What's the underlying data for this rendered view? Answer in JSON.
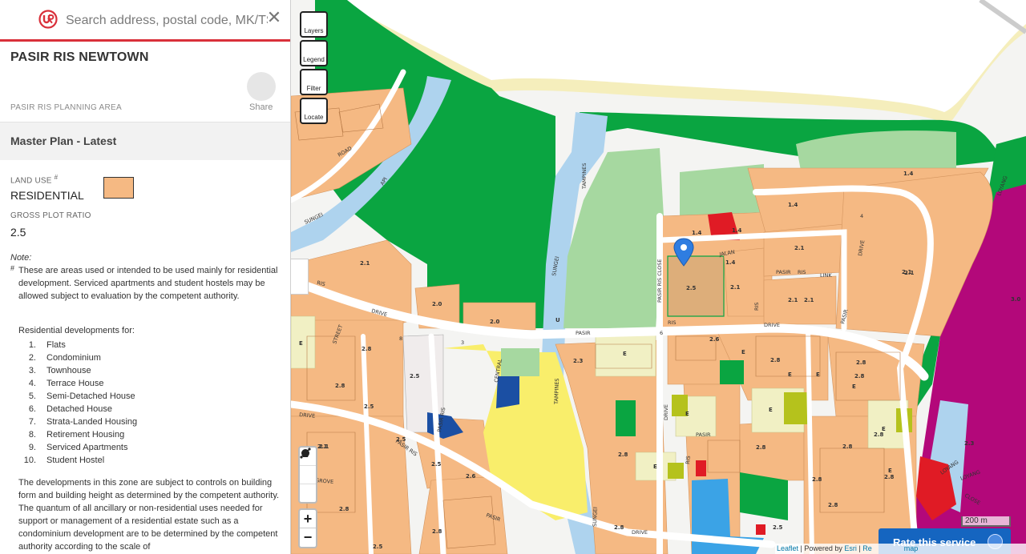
{
  "search": {
    "placeholder": "Search address, postal code, MK/TS Lot",
    "clear_label": "✕"
  },
  "place": {
    "title": "PASIR RIS NEWTOWN",
    "planning_area": "PASIR RIS PLANNING AREA",
    "share_label": "Share"
  },
  "plan": {
    "header": "Master Plan - Latest",
    "land_use_label": "LAND USE",
    "land_use_mark": "#",
    "land_use_value": "RESIDENTIAL",
    "land_use_color": "#f5b983",
    "gpr_label": "GROSS PLOT RATIO",
    "gpr_value": "2.5"
  },
  "note": {
    "label": "Note:",
    "mark": "#",
    "text": "These are areas used or intended to be used mainly for residential development. Serviced apartments and student hostels may be allowed subject to evaluation by the competent authority.",
    "list_intro": "Residential developments for:",
    "types": [
      "Flats",
      "Condominium",
      "Townhouse",
      "Terrace House",
      "Semi-Detached House",
      "Detached House",
      "Strata-Landed Housing",
      "Retirement Housing",
      "Serviced Apartments",
      "Student Hostel"
    ],
    "developments_text": "The developments in this zone are subject to controls on building form and building height as determined by the competent authority. The quantum of all ancillary or non-residential uses needed for support or management of a residential estate such as a condominium development are to be determined by the competent authority according to the scale of"
  },
  "map": {
    "controls": [
      "Layers",
      "Legend",
      "Filter",
      "Locate"
    ],
    "zoom_in": "+",
    "zoom_out": "−",
    "scale": "200 m",
    "rate_button": "Rate this service",
    "attribution": {
      "leaflet": "Leaflet",
      "sep1": " | Powered by ",
      "esri": "Esri",
      "sep2": " | ",
      "rest": "Re",
      "tail": "map"
    },
    "colors": {
      "residential": "#f5b983",
      "park": "#0aa541",
      "open_space": "#a6d8a0",
      "waterbody": "#aed3ee",
      "beach": "#f5eebc",
      "business": "#b3087a",
      "commercial": "#e01b25",
      "civic": "#f9ee6b",
      "education": "#f1f0c4",
      "transport": "#f0ecec",
      "health": "#3ba3e6",
      "utility": "#1b4fa3",
      "sports": "#b5c21c"
    },
    "labels": {
      "road_api": "API",
      "road_road": "ROAD",
      "road_sungei_1": "SUNGEI",
      "road_tampines": "TAMPINES",
      "road_sungei_2": "SUNGEI",
      "road_pasir_ris_close": "PASIR RIS CLOSE",
      "road_jalan": "JALAN",
      "road_loyang": "LOYANG",
      "road_drive_1": "DRIVE",
      "road_pasir_1": "PASIR",
      "road_ris_1": "RIS",
      "road_drive_2": "DRIVE",
      "road_pasir_2": "PASIR",
      "road_ris_2": "RIS",
      "road_link": "LINK",
      "road_ris_3": "RIS",
      "road_pasir_3": "PASIR",
      "road_ris_4": "RIS",
      "road_drive_3": "DRIVE",
      "road_central": "CENTRAL",
      "road_pasir_ris": "PASIR RIS",
      "road_tampines_2": "TAMPINES",
      "road_drive_4": "DRIVE",
      "road_pasir_4": "PASIR",
      "road_ris_5": "RIS",
      "road_drive_5": "DRIVE",
      "road_grove": "GROVE",
      "road_pasir_ris_2": "PASIR RIS",
      "road_street": "STREET",
      "road_pasir_5": "PASIR",
      "road_drive_6": "DRIVE",
      "road_sungei_3": "SUNGEI",
      "road_loyang_2": "LOYANG",
      "road_loyang_3": "LOYANG",
      "road_close": "CLOSE",
      "road_3": "3",
      "road_4": "4",
      "road_6": "6",
      "road_8": "8"
    },
    "plot_ratios": [
      "1.4",
      "1.4",
      "1.4",
      "1.4",
      "1.4",
      "2.1",
      "2.1",
      "2.1",
      "2.1",
      "2.1",
      "2.5",
      "2.0",
      "2.0",
      "2.8",
      "2.8",
      "2.8",
      "2.5",
      "2.5",
      "2.3",
      "2.6",
      "2.8",
      "2.8",
      "2.8",
      "2.8",
      "2.8",
      "2.5",
      "2.6",
      "2.1",
      "2.5",
      "2.8",
      "2.8",
      "2.5",
      "2.8",
      "2.8",
      "2.5",
      "2.8",
      "2.8",
      "2.3",
      "2.8",
      "3.0",
      "2.1",
      "2.1",
      "2.1"
    ],
    "zone_markers": [
      "E",
      "E",
      "E",
      "E",
      "E",
      "E",
      "E",
      "E",
      "E",
      "E",
      "E",
      "U"
    ]
  }
}
